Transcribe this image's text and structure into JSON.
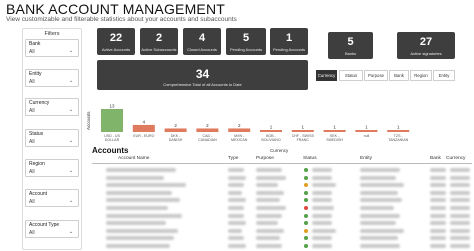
{
  "header": {
    "title": "BANK ACCOUNT MANAGEMENT",
    "subtitle": "View customizable and filterable statistics about your accounts and subaccounts"
  },
  "filters": {
    "title": "Filters",
    "items": [
      {
        "label": "Bank",
        "value": "All"
      },
      {
        "label": "Entity",
        "value": "All"
      },
      {
        "label": "Currency",
        "value": "All"
      },
      {
        "label": "Status",
        "value": "All"
      },
      {
        "label": "Region",
        "value": "All"
      },
      {
        "label": "Account",
        "value": "All"
      },
      {
        "label": "Account Type",
        "value": "All"
      }
    ]
  },
  "kpis": [
    {
      "value": "22",
      "label": "Active Accounts"
    },
    {
      "value": "2",
      "label": "Active Subaccounts"
    },
    {
      "value": "4",
      "label": "Closed Accounts"
    },
    {
      "value": "5",
      "label": "Pending Accounts"
    },
    {
      "value": "1",
      "label": "Pending Accounts"
    },
    {
      "value": "5",
      "label": "Banks"
    },
    {
      "value": "27",
      "label": "Active signatories"
    }
  ],
  "total": {
    "value": "34",
    "label": "Comprehensive Total of all Accounts to Date"
  },
  "tabs": [
    "Currency",
    "Status",
    "Purpose",
    "Bank",
    "Region",
    "Entity"
  ],
  "colors": {
    "highlight": "#7fb46a",
    "accent": "#e07a5f",
    "card": "#3e3e3e"
  },
  "chart_data": {
    "type": "bar",
    "title": "",
    "xlabel": "Currency",
    "ylabel": "Accounts",
    "categories": [
      "USD - US DOLLAR",
      "EUR - EURO",
      "DKK - DANISH KRONE",
      "CAD - CANADIAN DOLLAR",
      "MXN - MEXICAN PESO",
      "BOB - BOLIVIANO",
      "CHF - SWISS FRANC",
      "SEK - SWEDISH KRONA",
      "null",
      "TZS - TANZANIAN SHILLING"
    ],
    "values": [
      13,
      4,
      2,
      2,
      2,
      1,
      1,
      1,
      1,
      1
    ],
    "data_labels": [
      "13",
      "4",
      "2",
      "2",
      "2",
      "1",
      "1",
      "1",
      "1",
      "1"
    ],
    "highlight_index": 0,
    "ylim": [
      0,
      13
    ]
  },
  "table": {
    "title": "Accounts",
    "columns": [
      "Account Name",
      "Type",
      "Purpose",
      "Status",
      "Entity",
      "Bank",
      "Currency"
    ],
    "row_count": 11,
    "status_colors": [
      "#56a04b",
      "#56a04b",
      "#e0a020",
      "#56a04b",
      "#56a04b",
      "#e04a3a",
      "#56a04b",
      "#56a04b",
      "#e0a020",
      "#56a04b",
      "#56a04b"
    ]
  }
}
